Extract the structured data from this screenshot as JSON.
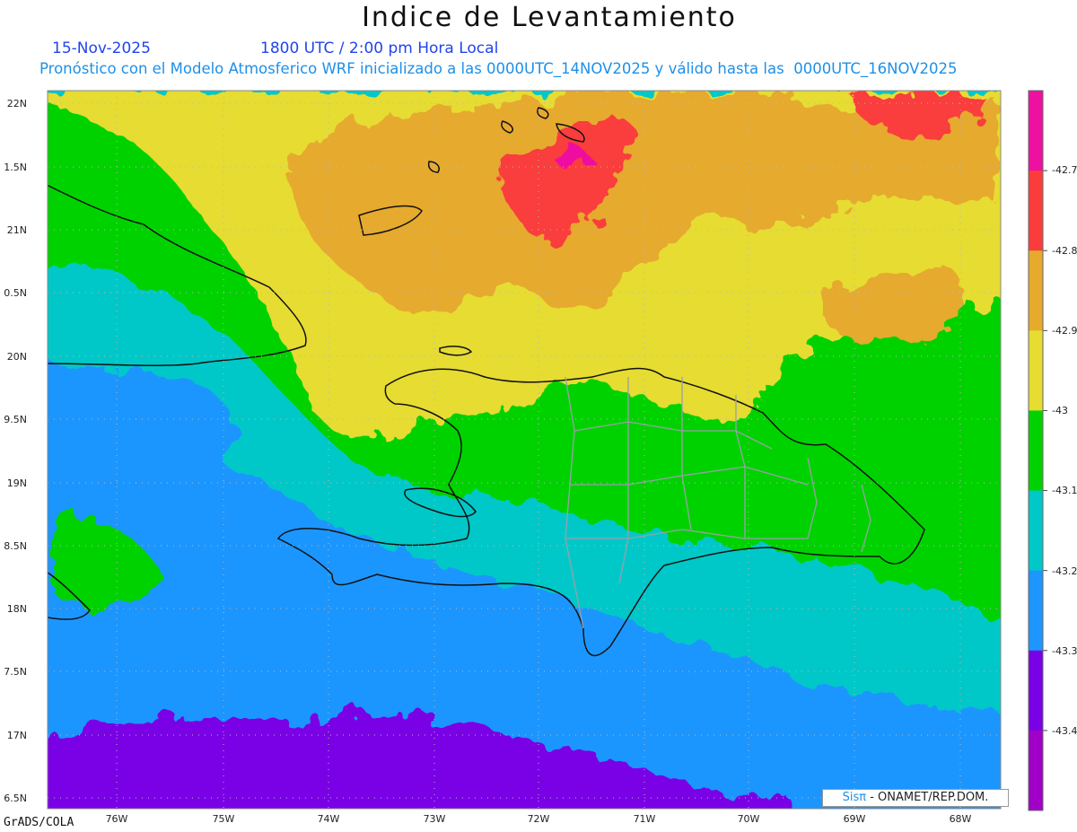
{
  "header": {
    "title": "Indice de Levantamiento",
    "date": "15-Nov-2025",
    "time": "1800 UTC / 2:00 pm Hora Local",
    "subtitle": "Pronóstico con el Modelo Atmosferico WRF inicializado a las 0000UTC_14NOV2025 y válido hasta las  0000UTC_16NOV2025"
  },
  "map": {
    "lat_labels": [
      "22N",
      "1.5N",
      "21N",
      "0.5N",
      "20N",
      "9.5N",
      "19N",
      "8.5N",
      "18N",
      "7.5N",
      "17N",
      "6.5N"
    ],
    "lon_labels": [
      "76W",
      "75W",
      "74W",
      "73W",
      "72W",
      "71W",
      "70W",
      "69W",
      "68W"
    ],
    "lat_range": [
      16.5,
      22
    ],
    "lon_range": [
      -76.5,
      -67.5
    ],
    "grid": true
  },
  "colorbar": {
    "labels": [
      "-42.7",
      "-42.8",
      "-42.9",
      "-43",
      "-43.1",
      "-43.2",
      "-43.3",
      "-43.4"
    ],
    "colors": [
      "#ee10a0",
      "#fa3c3c",
      "#e6aa2d",
      "#e6dc32",
      "#00d200",
      "#00c8c8",
      "#1e96ff",
      "#7a00e6",
      "#a000c8"
    ]
  },
  "credit": "GrADS/COLA",
  "logo": {
    "sis": "Sisπ",
    "rest": " - ONAMET/REP.DOM."
  }
}
